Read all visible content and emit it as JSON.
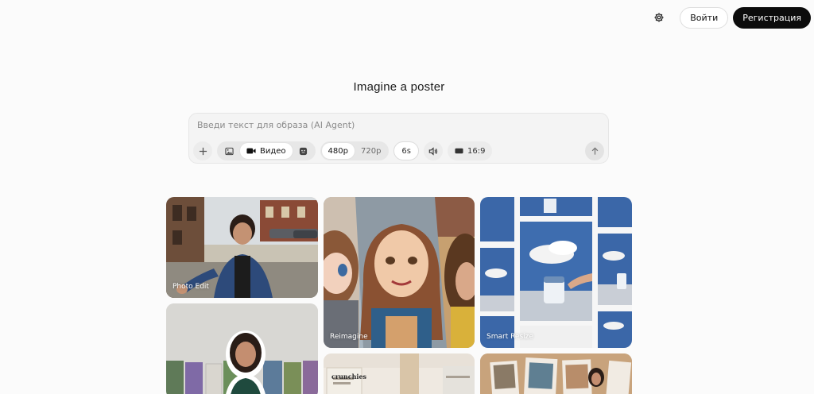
{
  "header": {
    "login_label": "Войти",
    "register_label": "Регистрация",
    "settings_icon": "gear-icon"
  },
  "hero": {
    "title": "Imagine a poster"
  },
  "prompt": {
    "placeholder": "Введи текст для образа (AI Agent)",
    "value": "",
    "add_icon": "plus-icon",
    "modes": [
      {
        "icon": "image-icon",
        "label": "",
        "active": false
      },
      {
        "icon": "video-camera-icon",
        "label": "Видео",
        "active": true
      },
      {
        "icon": "avatar-icon",
        "label": "",
        "active": false
      }
    ],
    "resolutions": [
      {
        "label": "480p",
        "active": true
      },
      {
        "label": "720p",
        "active": false
      }
    ],
    "duration": "6s",
    "sound_icon": "speaker-icon",
    "aspect_icon": "aspect-ratio-icon",
    "aspect_ratio": "16:9",
    "send_icon": "arrow-up-icon"
  },
  "gallery": {
    "cards": [
      {
        "label": "Photo Edit"
      },
      {
        "label": "Reimagine"
      },
      {
        "label": "Smart Resize"
      },
      {
        "label": ""
      },
      {
        "label": "",
        "caption": "crunchies"
      },
      {
        "label": ""
      }
    ]
  },
  "colors": {
    "background": "#fbfbfb",
    "primary_button": "#0c0c0c",
    "prompt_box": "#f4f4f4"
  }
}
